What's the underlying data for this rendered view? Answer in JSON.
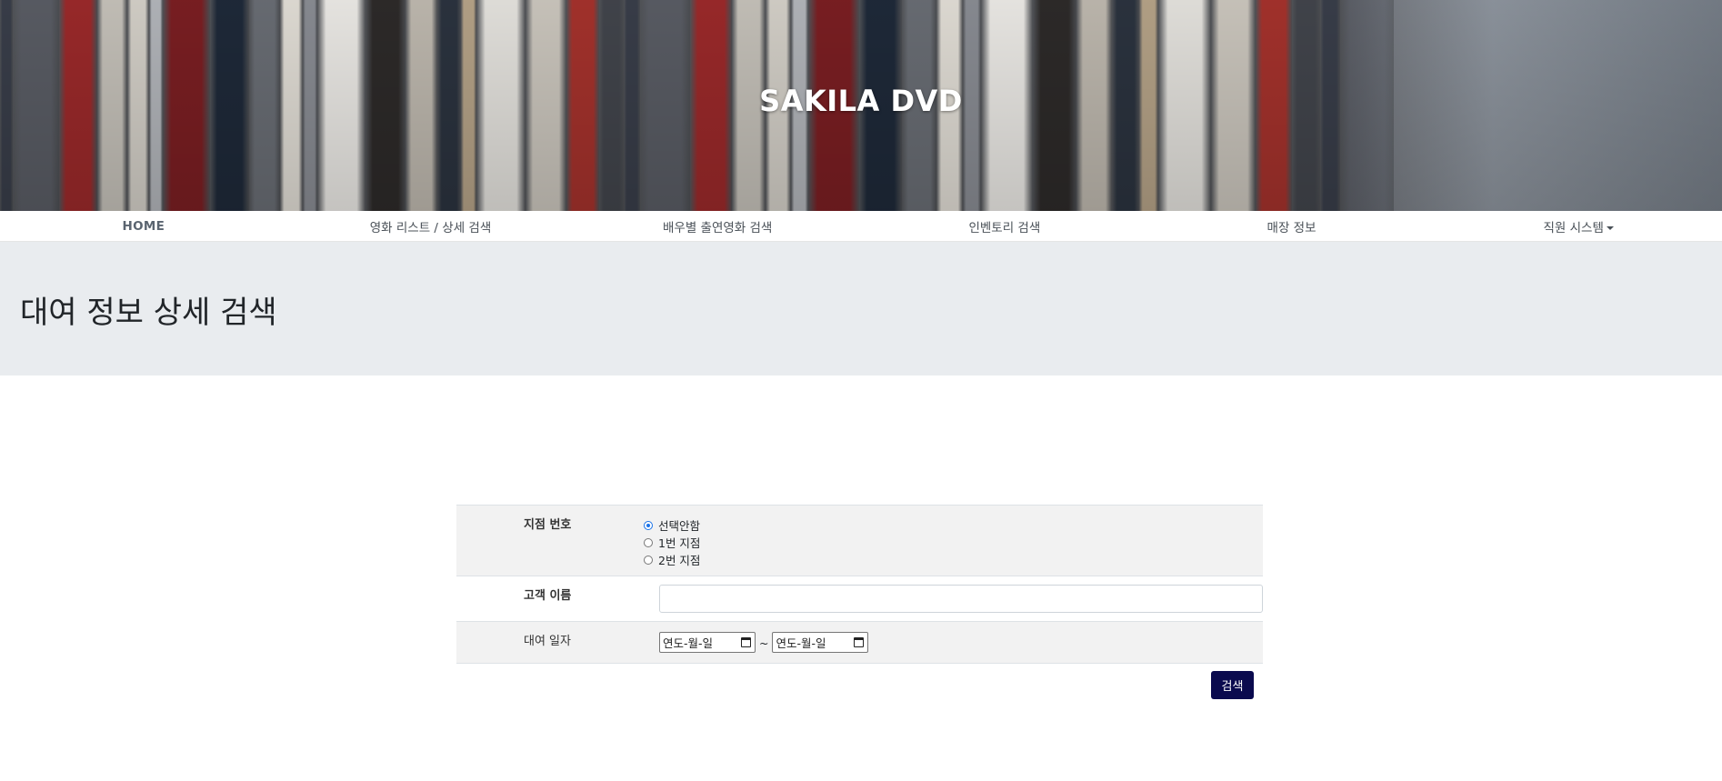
{
  "header": {
    "title": "SAKILA DVD"
  },
  "nav": {
    "items": [
      {
        "label": "HOME"
      },
      {
        "label": "영화 리스트 / 상세 검색"
      },
      {
        "label": "배우별 출연영화 검색"
      },
      {
        "label": "인벤토리 검색"
      },
      {
        "label": "매장 정보"
      },
      {
        "label": "직원 시스템"
      }
    ]
  },
  "page": {
    "heading": "대여 정보 상세 검색"
  },
  "form": {
    "store": {
      "label": "지점 번호",
      "options": [
        "선택안함",
        "1번 지점",
        "2번 지점"
      ],
      "selected": "선택안함"
    },
    "customer": {
      "label": "고객 이름",
      "value": ""
    },
    "rental_date": {
      "label": "대여 일자",
      "from_placeholder": "연도-월-일",
      "separator": "~",
      "to_placeholder": "연도-월-일"
    },
    "submit_label": "검색"
  },
  "colors": {
    "accent_button": "#0a0a4e",
    "jumbotron_bg": "#e9ecef",
    "row_alt_bg": "#f2f2f2"
  }
}
